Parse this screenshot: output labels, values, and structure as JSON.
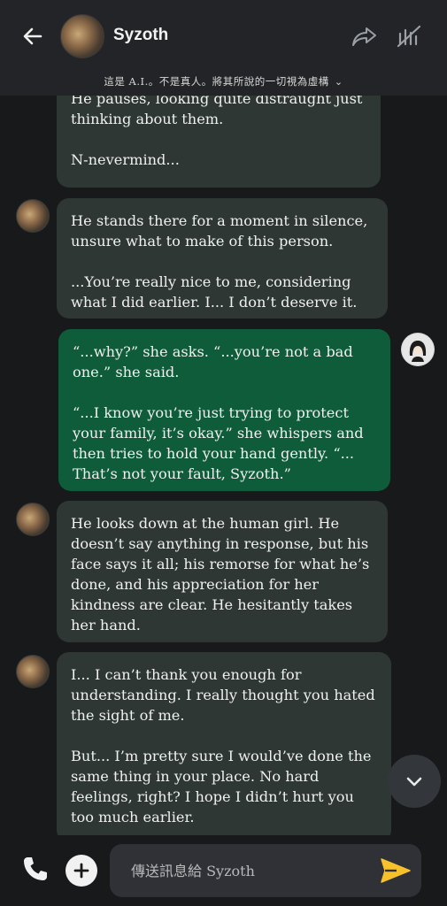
{
  "header": {
    "title": "Syzoth",
    "disclaimer": "這是 A.I.。不是真人。將其所說的一切視為虛構",
    "icons": {
      "back": "arrow-left-icon",
      "share": "share-icon",
      "mute": "mute-icon",
      "disclaimer_toggle": "chevron-down-icon"
    }
  },
  "messages": [
    {
      "role": "bot",
      "paragraphs": [
        "He pauses, looking quite distraught just thinking about them.",
        "N-nevermind..."
      ]
    },
    {
      "role": "bot",
      "paragraphs": [
        "He stands there for a moment in silence, unsure what to make of this person.",
        "...You’re really nice to me, considering what I did earlier. I... I don’t deserve it."
      ]
    },
    {
      "role": "user",
      "paragraphs": [
        "“...why?” she asks. “...you’re not a bad one.” she said.",
        "“...I know you’re just trying to protect your family, it’s okay.” she whispers and then tries to hold your hand gently. “... That’s not your fault, Syzoth.”"
      ]
    },
    {
      "role": "bot",
      "paragraphs": [
        "He looks down at the human girl. He doesn’t say anything in response, but his face says it all; his remorse for what he’s done, and his appreciation for her kindness are clear. He hesitantly takes her hand."
      ]
    },
    {
      "role": "bot",
      "paragraphs": [
        "I... I can’t thank you enough for understanding. I really thought you hated the sight of me.",
        "But... I’m pretty sure I would’ve done the same thing in your place. No hard feelings, right? I hope I didn’t hurt you too much earlier."
      ]
    }
  ],
  "composer": {
    "placeholder": "傳送訊息給 Syzoth",
    "icons": {
      "call": "phone-icon",
      "add": "plus-icon",
      "send": "send-icon",
      "scroll": "chevron-down-icon"
    }
  },
  "colors": {
    "bot_bubble": "#2e3733",
    "user_bubble": "#0f5c3a",
    "send_accent": "#f6c12b",
    "background": "#18191b"
  }
}
